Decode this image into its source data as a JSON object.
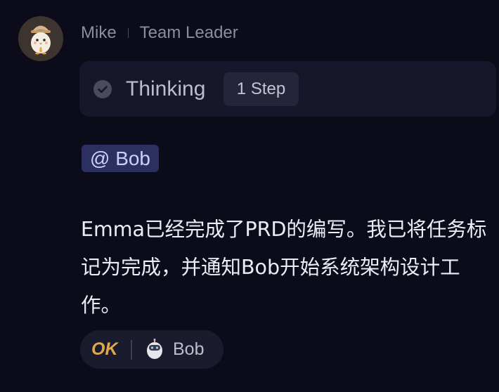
{
  "header": {
    "sender_name": "Mike",
    "sender_role": "Team Leader"
  },
  "thinking": {
    "label": "Thinking",
    "step_badge": "1 Step"
  },
  "mention": {
    "text": "@ Bob"
  },
  "message": {
    "text": "Emma已经完成了PRD的编写。我已将任务标记为完成，并通知Bob开始系统架构设计工作。"
  },
  "reaction": {
    "ok_label": "OK",
    "agent_name": "Bob"
  },
  "colors": {
    "background": "#0b0b1a",
    "card": "#16172a",
    "mention_bg": "#2b3060",
    "ok_accent": "#e0a84b"
  },
  "icons": {
    "avatar": "egg-mascot-avatar-icon",
    "thinking_status": "check-circle-icon",
    "reaction_agent": "robot-egg-icon"
  }
}
